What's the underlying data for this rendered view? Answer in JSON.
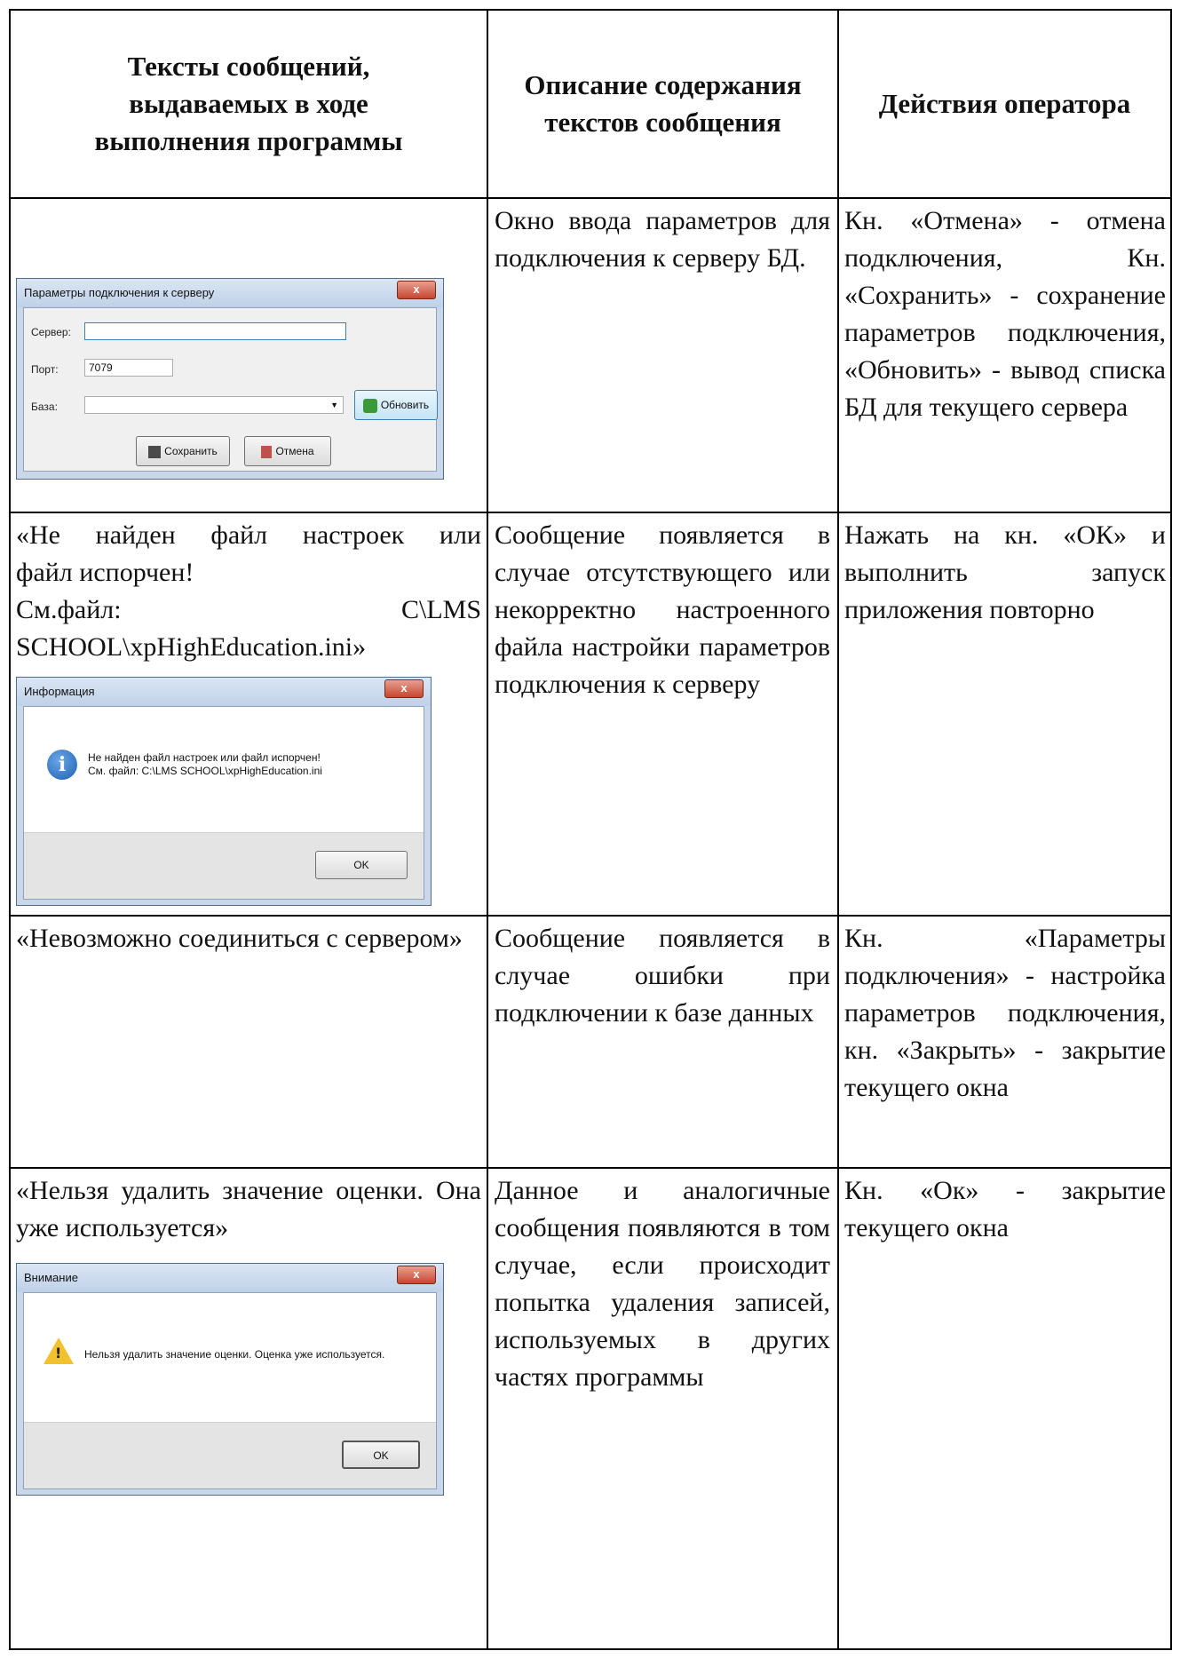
{
  "headers": {
    "col1": "Тексты сообщений, выдаваемых в ходе выполнения программы",
    "col2": "Описание содержания текстов сообщения",
    "col3": "Действия оператора"
  },
  "rows": [
    {
      "message": "",
      "description": "Окно ввода параметров для подключения к серверу БД.",
      "action": "Кн. «Отмена» - отмена подключения, Кн. «Сохранить» - сохранение параметров подключения, «Обновить» - вывод списка БД для текущего сервера",
      "dialog": {
        "title": "Параметры подключения к серверу",
        "server_label": "Сервер:",
        "server_value": "",
        "port_label": "Порт:",
        "port_value": "7079",
        "base_label": "База:",
        "base_value": "",
        "refresh_label": "Обновить",
        "save_label": "Сохранить",
        "cancel_label": "Отмена"
      }
    },
    {
      "message_lines": [
        "«Не найден файл настроек или",
        "файл испорчен!",
        "См.файл:",
        "C\\LMS",
        "SCHOOL\\xpHighEducation.ini»"
      ],
      "description": "Сообщение появляется в случае отсутствующего или некорректно настроенного файла настройки параметров подключения к серверу",
      "action": "Нажать на кн. «ОК» и выполнить запуск приложения повторно",
      "dialog": {
        "title": "Информация",
        "text_line1": "Не найден файл настроек или файл испорчен!",
        "text_line2": "См. файл: C:\\LMS SCHOOL\\xpHighEducation.ini",
        "ok_label": "OK"
      }
    },
    {
      "message": "«Невозможно соединиться с сервером»",
      "description": "Сообщение появляется в случае ошибки при подключении к базе данных",
      "action": "Кн. «Параметры подключения» - настройка параметров подключения, кн. «Закрыть» - закрытие текущего окна"
    },
    {
      "message": "«Нельзя удалить значение оценки. Она уже используется»",
      "description": "Данное и аналогичные сообщения появляются в том случае, если происходит попытка удаления записей, используемых в других частях программы",
      "action": "Кн. «Ок» - закрытие текущего окна",
      "dialog": {
        "title": "Внимание",
        "text": "Нельзя удалить значение оценки. Оценка уже используется.",
        "ok_label": "OK"
      }
    }
  ]
}
